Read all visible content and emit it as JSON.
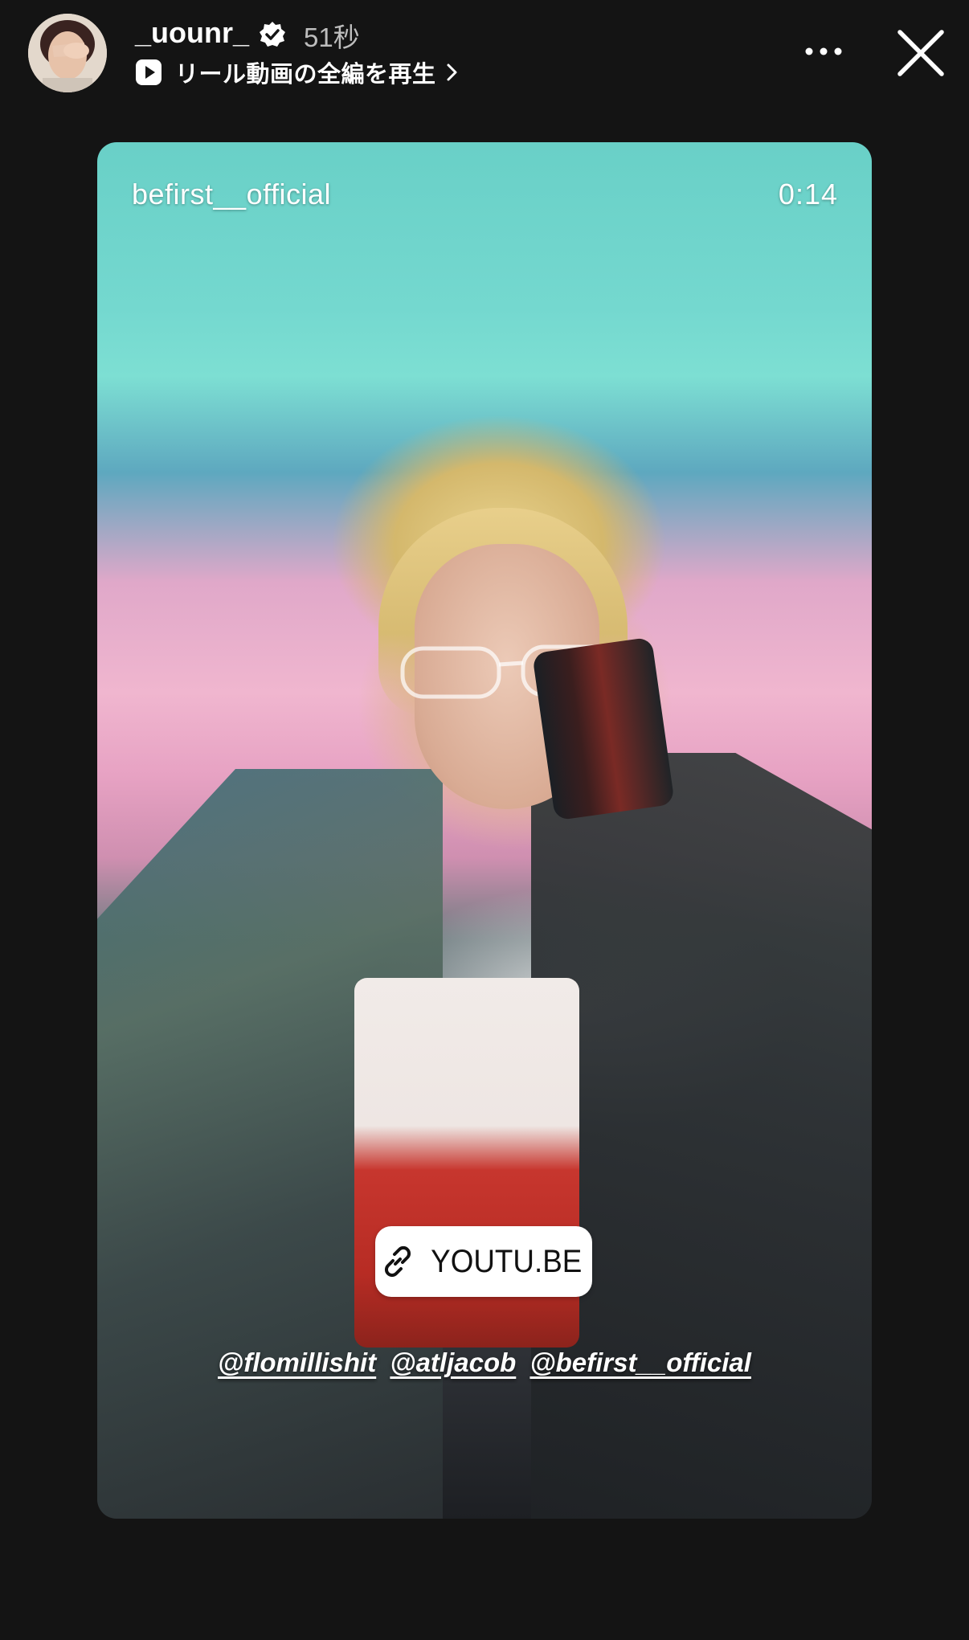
{
  "header": {
    "username": "_uounr_",
    "verified_icon": "verified-badge-icon",
    "time_ago": "51秒",
    "reel_link_text": "リール動画の全編を再生",
    "more_icon": "more-options-icon",
    "close_icon": "close-icon"
  },
  "story": {
    "account": "befirst__official",
    "timestamp": "0:14",
    "link_sticker": {
      "icon": "link-icon",
      "label": "YOUTU.BE"
    },
    "mentions": [
      "@flomillishit",
      "@atljacob",
      "@befirst__official"
    ]
  },
  "colors": {
    "background": "#141414",
    "accent_teal": "#74d8cf",
    "accent_pink": "#f0b6cf"
  }
}
